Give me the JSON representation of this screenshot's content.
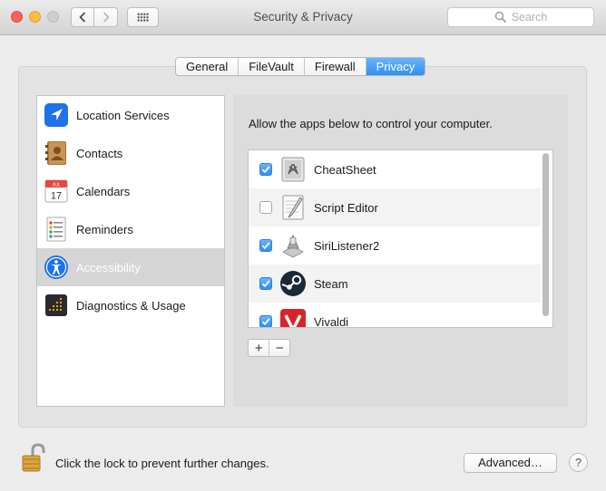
{
  "window": {
    "title": "Security & Privacy",
    "search_placeholder": "Search"
  },
  "toolbar": {
    "back_icon": "chevron-left-icon",
    "forward_icon": "chevron-right-icon",
    "show_all_icon": "grid-icon"
  },
  "tabs": [
    {
      "label": "General",
      "active": false
    },
    {
      "label": "FileVault",
      "active": false
    },
    {
      "label": "Firewall",
      "active": false
    },
    {
      "label": "Privacy",
      "active": true
    }
  ],
  "sidebar": {
    "items": [
      {
        "label": "Location Services",
        "icon": "location-arrow-icon",
        "selected": false
      },
      {
        "label": "Contacts",
        "icon": "contacts-book-icon",
        "selected": false
      },
      {
        "label": "Calendars",
        "icon": "calendar-icon",
        "selected": false
      },
      {
        "label": "Reminders",
        "icon": "reminders-list-icon",
        "selected": false
      },
      {
        "label": "Accessibility",
        "icon": "accessibility-icon",
        "selected": true
      },
      {
        "label": "Diagnostics & Usage",
        "icon": "diagnostics-icon",
        "selected": false
      }
    ],
    "calendar_month": "JUL",
    "calendar_day": "17"
  },
  "main": {
    "instructions": "Allow the apps below to control your computer.",
    "apps": [
      {
        "label": "CheatSheet",
        "checked": true,
        "icon": "cheatsheet-app-icon"
      },
      {
        "label": "Script Editor",
        "checked": false,
        "icon": "script-editor-app-icon"
      },
      {
        "label": "SiriListener2",
        "checked": true,
        "icon": "sirilistener-app-icon"
      },
      {
        "label": "Steam",
        "checked": true,
        "icon": "steam-app-icon"
      },
      {
        "label": "Vivaldi",
        "checked": true,
        "icon": "vivaldi-app-icon"
      }
    ],
    "add_label": "+",
    "remove_label": "−"
  },
  "footer": {
    "lock_text": "Click the lock to prevent further changes.",
    "advanced_label": "Advanced…",
    "help_label": "?"
  },
  "colors": {
    "accent": "#2d8ff6",
    "window_bg": "#ececec",
    "selection_bg": "#d5d5d5"
  }
}
